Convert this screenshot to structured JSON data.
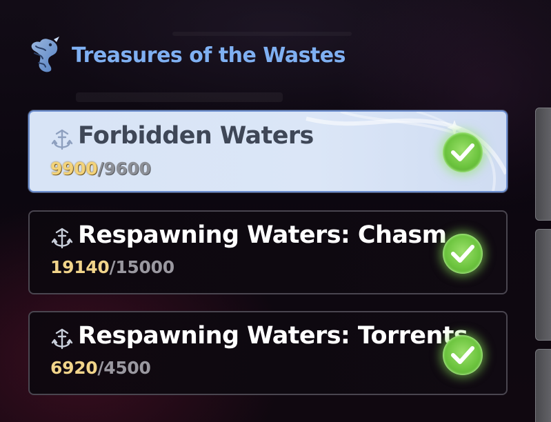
{
  "header": {
    "title": "Treasures of the Wastes",
    "icon": "seahorse-emblem-icon"
  },
  "quests": [
    {
      "title": "Forbidden Waters",
      "current": "9900",
      "separator": "/",
      "target": "9600",
      "state": "selected",
      "completed": true,
      "icon": "anchor-trident-icon"
    },
    {
      "title": "Respawning Waters: Chasm",
      "current": "19140",
      "separator": "/",
      "target": "15000",
      "state": "normal",
      "completed": true,
      "icon": "anchor-trident-icon"
    },
    {
      "title": "Respawning Waters: Torrents",
      "current": "6920",
      "separator": "/",
      "target": "4500",
      "state": "normal",
      "completed": true,
      "icon": "anchor-trident-icon"
    }
  ],
  "colors": {
    "title_blue": "#7fb0f2",
    "progress_gold": "#f1d48a",
    "check_green": "#6cc43e",
    "selected_card": "#d8e4f6"
  }
}
